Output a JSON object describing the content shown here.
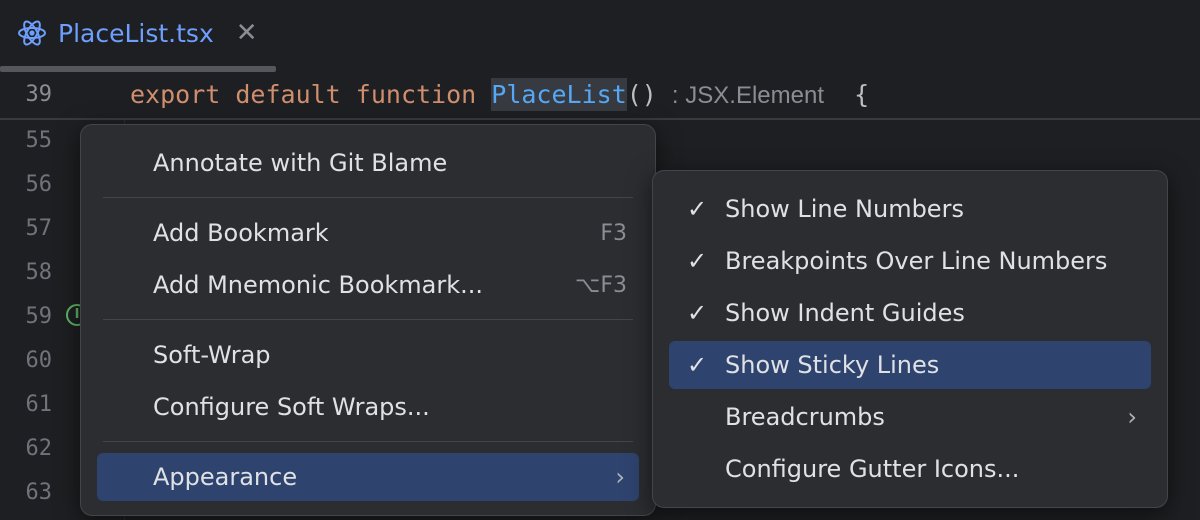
{
  "tab": {
    "title": "PlaceList.tsx",
    "close_glyph": "✕",
    "icon": "react-icon"
  },
  "sticky": {
    "line": "39",
    "kw_export": "export",
    "kw_default": "default",
    "kw_function": "function",
    "fn_name": "PlaceList",
    "parens": "()",
    "type_hint": ": JSX.Element",
    "brace": "{"
  },
  "gutter_lines": [
    "55",
    "56",
    "57",
    "58",
    "59",
    "60",
    "61",
    "62",
    "63"
  ],
  "context_menu": {
    "annotate": "Annotate with Git Blame",
    "add_bookmark": "Add Bookmark",
    "add_bookmark_shortcut": "F3",
    "add_mnemonic": "Add Mnemonic Bookmark...",
    "add_mnemonic_shortcut": "⌥F3",
    "soft_wrap": "Soft-Wrap",
    "configure_soft_wraps": "Configure Soft Wraps...",
    "appearance": "Appearance",
    "submenu_arrow": "›"
  },
  "appearance_menu": {
    "check_glyph": "✓",
    "show_line_numbers": "Show Line Numbers",
    "breakpoints_over": "Breakpoints Over Line Numbers",
    "show_indent_guides": "Show Indent Guides",
    "show_sticky_lines": "Show Sticky Lines",
    "breadcrumbs": "Breadcrumbs",
    "configure_gutter_icons": "Configure Gutter Icons...",
    "submenu_arrow": "›"
  },
  "colors": {
    "accent": "#2e436e",
    "tab_title": "#6e9fff",
    "keyword": "#cf8e6d",
    "function": "#56a8f5"
  }
}
